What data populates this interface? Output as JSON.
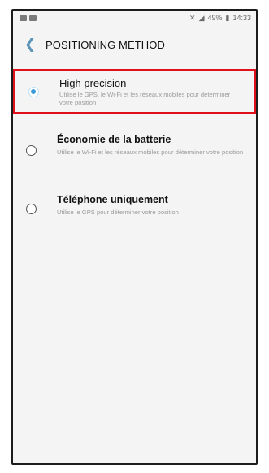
{
  "status_bar": {
    "battery_text": "49%",
    "time": "14:33"
  },
  "header": {
    "title": "POSITIONING METHOD"
  },
  "options": [
    {
      "title": "High precision",
      "description": "Utilise le GPS, le Wi-Fi et les réseaux mobiles pour déterminer votre position",
      "selected": true
    },
    {
      "title": "Économie de la batterie",
      "description": "Utilise le Wi-Fi et les réseaux mobiles pour déterminer votre position",
      "selected": false
    },
    {
      "title": "Téléphone uniquement",
      "description": "Utilise le GPS pour déterminer votre position",
      "selected": false
    }
  ],
  "colors": {
    "accent": "#3d9ad8",
    "highlight": "#e0101a",
    "back_arrow": "#5c93b8"
  },
  "icons": {
    "back": "chevron-left-icon"
  }
}
